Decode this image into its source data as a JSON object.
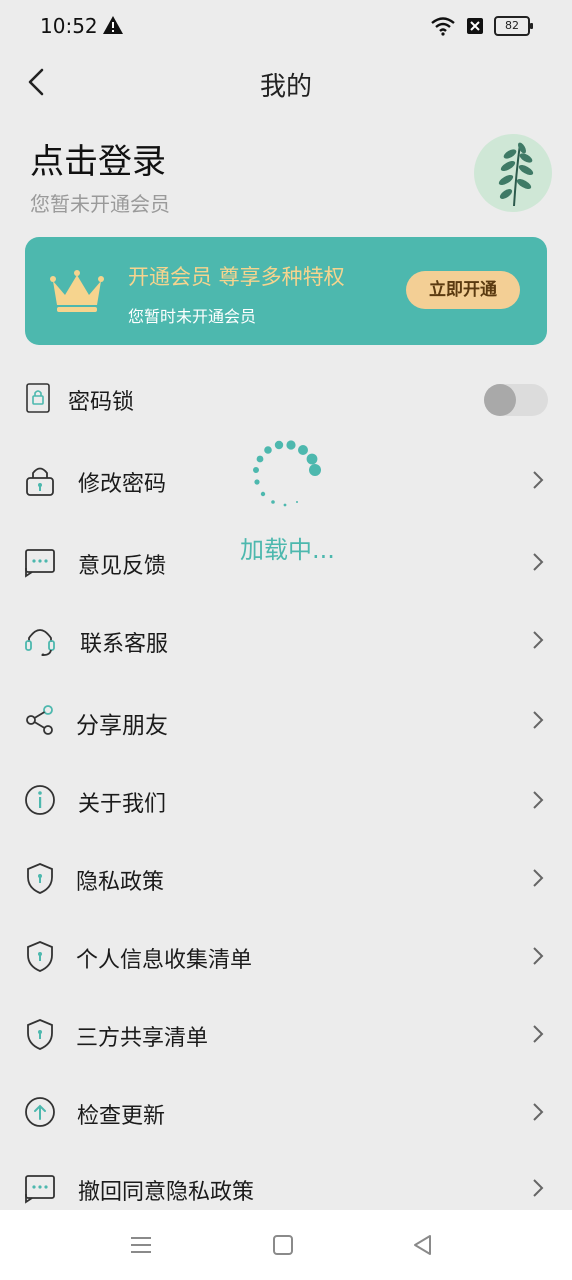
{
  "status_bar": {
    "time": "10:52",
    "battery": "82"
  },
  "header": {
    "title": "我的"
  },
  "user": {
    "login_text": "点击登录",
    "membership_status": "您暂未开通会员"
  },
  "vip_banner": {
    "title": "开通会员  尊享多种特权",
    "subtitle": "您暂时未开通会员",
    "button": "立即开通"
  },
  "menu": [
    {
      "label": "密码锁",
      "icon": "lock-icon",
      "type": "toggle",
      "on": false
    },
    {
      "label": "修改密码",
      "icon": "padlock-icon",
      "type": "link"
    },
    {
      "label": "意见反馈",
      "icon": "feedback-icon",
      "type": "link"
    },
    {
      "label": "联系客服",
      "icon": "headset-icon",
      "type": "link"
    },
    {
      "label": "分享朋友",
      "icon": "share-icon",
      "type": "link"
    },
    {
      "label": "关于我们",
      "icon": "info-icon",
      "type": "link"
    },
    {
      "label": "隐私政策",
      "icon": "shield-icon",
      "type": "link"
    },
    {
      "label": "个人信息收集清单",
      "icon": "shield-icon",
      "type": "link"
    },
    {
      "label": "三方共享清单",
      "icon": "shield-icon",
      "type": "link"
    },
    {
      "label": "检查更新",
      "icon": "upload-icon",
      "type": "link"
    },
    {
      "label": "撤回同意隐私政策",
      "icon": "feedback-icon",
      "type": "link"
    }
  ],
  "loading": {
    "text": "加载中..."
  },
  "colors": {
    "accent": "#4db8ae",
    "banner_title": "#f6d48e",
    "banner_button": "#f3cf95",
    "background": "#ececec"
  }
}
